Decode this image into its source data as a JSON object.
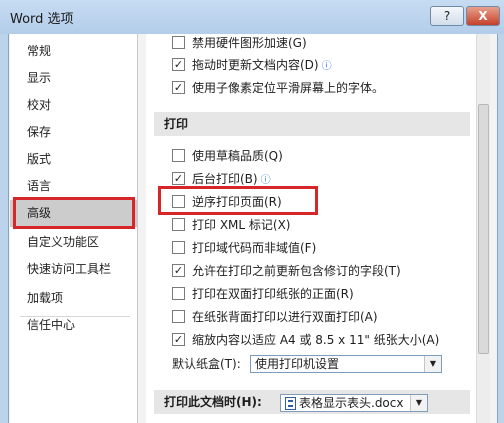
{
  "window": {
    "title": "Word 选项",
    "help_label": "?",
    "close_label": "X"
  },
  "sidebar": {
    "items": [
      {
        "label": "常规"
      },
      {
        "label": "显示"
      },
      {
        "label": "校对"
      },
      {
        "label": "保存"
      },
      {
        "label": "版式"
      },
      {
        "label": "语言"
      },
      {
        "label": "高级"
      },
      {
        "label": "自定义功能区"
      },
      {
        "label": "快速访问工具栏"
      },
      {
        "label": "加载项"
      },
      {
        "label": "信任中心"
      }
    ],
    "selected": "高级"
  },
  "display_options": [
    {
      "label": "禁用硬件图形加速(G)",
      "checked": false
    },
    {
      "label": "拖动时更新文档内容(D)",
      "checked": true
    },
    {
      "label": "使用子像素定位平滑屏幕上的字体。",
      "checked": true
    }
  ],
  "print_section": {
    "title": "打印",
    "options": [
      {
        "label": "使用草稿品质(Q)",
        "checked": false
      },
      {
        "label": "后台打印(B)",
        "checked": true
      },
      {
        "label": "逆序打印页面(R)",
        "checked": false
      },
      {
        "label": "打印 XML 标记(X)",
        "checked": false
      },
      {
        "label": "打印域代码而非域值(F)",
        "checked": false
      },
      {
        "label": "允许在打印之前更新包含修订的字段(T)",
        "checked": true
      },
      {
        "label": "打印在双面打印纸张的正面(R)",
        "checked": false
      },
      {
        "label": "在纸张背面打印以进行双面打印(A)",
        "checked": false
      },
      {
        "label": "缩放内容以适应 A4 或 8.5 x 11\" 纸张大小(A)",
        "checked": true
      }
    ],
    "default_tray_label": "默认纸盒(T):",
    "default_tray_value": "使用打印机设置"
  },
  "doc_print_section": {
    "title": "打印此文档时(H):",
    "document_value": "表格显示表头.docx"
  },
  "icons": {
    "check": "✓",
    "info": "ⓘ",
    "dropdown": "▼"
  }
}
